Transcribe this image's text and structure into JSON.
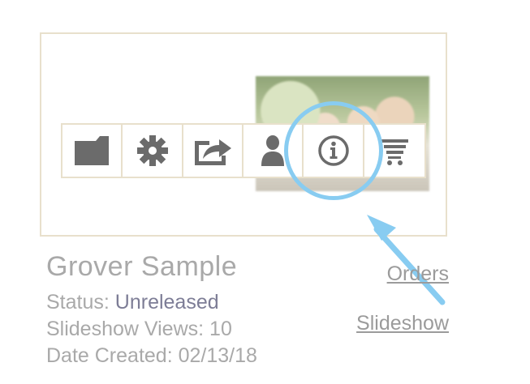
{
  "gallery": {
    "title": "Grover Sample",
    "status_label": "Status:",
    "status_value": "Unreleased",
    "views_label": "Slideshow Views:",
    "views_value": "10",
    "date_label": "Date Created:",
    "date_value": "02/13/18"
  },
  "links": {
    "orders": "Orders",
    "slideshow": "Slideshow"
  },
  "toolbar": {
    "icons": [
      "folder-icon",
      "gear-icon",
      "share-icon",
      "person-icon",
      "info-icon",
      "cart-icon"
    ]
  },
  "colors": {
    "border": "#e8e0cc",
    "icon": "#6b6b6b",
    "highlight": "#88ccf1",
    "text": "#a9a9a9"
  }
}
